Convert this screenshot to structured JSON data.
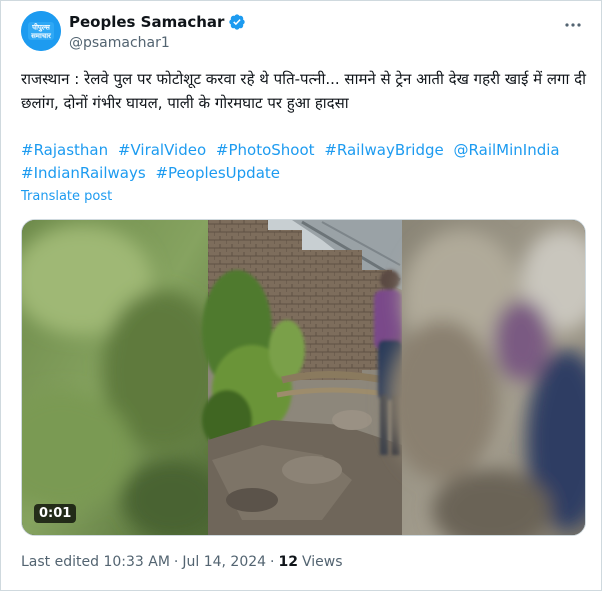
{
  "account": {
    "display_name": "Peoples Samachar",
    "handle": "@psamachar1",
    "avatar_text_top": "पीपुल्स",
    "avatar_text_bottom": "समाचार"
  },
  "tweet": {
    "text": "राजस्थान : रेलवे पुल पर फोटोशूट करवा रहे थे पति-पत्नी... सामने से ट्रेन आती देख गहरी खाई में लगा दी छलांग, दोनों गंभीर घायल, पाली के गोरमघाट पर हुआ हादसा",
    "hashtags": [
      "#Rajasthan",
      "#ViralVideo",
      "#PhotoShoot",
      "#RailwayBridge",
      "@RailMinIndia",
      "#IndianRailways",
      "#PeoplesUpdate"
    ],
    "translate_label": "Translate post"
  },
  "media": {
    "duration": "0:01"
  },
  "meta": {
    "edited": "Last edited 10:33 AM",
    "separator": "·",
    "date": "Jul 14, 2024",
    "views_count": "12",
    "views_label": "Views"
  },
  "icons": {
    "verified": "verified-badge-icon",
    "more": "more-options-icon"
  },
  "colors": {
    "accent": "#1d9bf0",
    "text": "#0f1419",
    "secondary": "#536471",
    "border": "#cfd9de"
  }
}
